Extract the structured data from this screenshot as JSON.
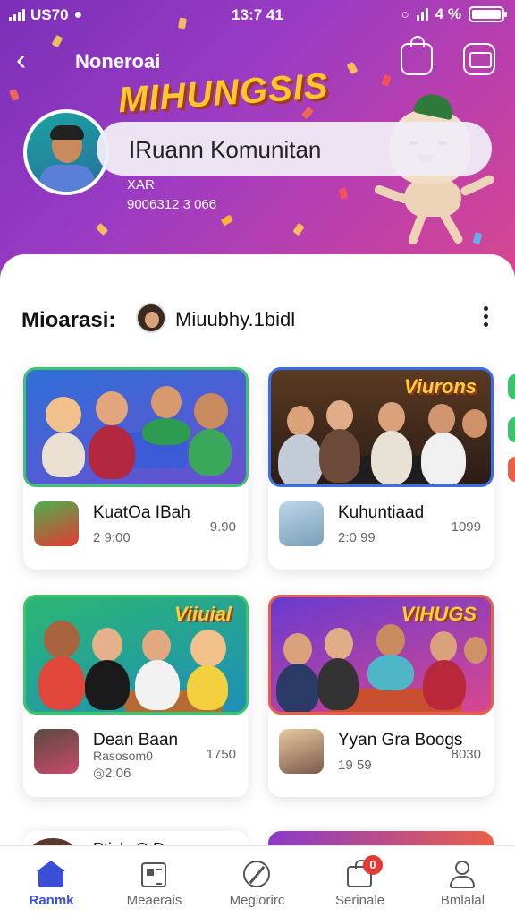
{
  "status": {
    "carrier": "US70",
    "time": "13:7 41",
    "battery": "4 %",
    "battery_level": 0.9
  },
  "header": {
    "title": "Noneroai",
    "banner_word": "MIHUNGSIS"
  },
  "profile": {
    "name": "IRuann Komunitan",
    "line1": "XAR",
    "line2": "9006312 3 066"
  },
  "section": {
    "title": "Mioarasi:",
    "user": "Miuubhy.1bidl"
  },
  "cards": [
    {
      "title": "KuatOa IBah",
      "sub": "2 9:00",
      "count": "9.90",
      "scene_title": ""
    },
    {
      "title": "Kuhuntiaad",
      "sub": "2:0 99",
      "count": "1099",
      "scene_title": "Viurons"
    },
    {
      "title": "Dean Baan",
      "sub": "Rasosom0",
      "sub2": "◎2:06",
      "count": "1750",
      "scene_title": "Viiuial"
    },
    {
      "title": "Yyan Gra Boogs",
      "sub": "19 59",
      "count": "8030",
      "scene_title": "VIHUGS"
    }
  ],
  "peek": {
    "label": "Ptisly O.D"
  },
  "tabs": [
    {
      "label": "Ranmk",
      "icon": "home-icon",
      "active": true
    },
    {
      "label": "Meaerais",
      "icon": "newspaper-icon",
      "active": false
    },
    {
      "label": "Megiorirc",
      "icon": "compass-icon",
      "active": false
    },
    {
      "label": "Serinale",
      "icon": "shopping-bag-icon",
      "active": false,
      "badge": "0"
    },
    {
      "label": "Bmlalal",
      "icon": "user-icon",
      "active": false
    }
  ],
  "colors": {
    "accent": "#3a4ed8",
    "hero_start": "#7a2fb8",
    "hero_end": "#d8478f",
    "badge": "#e53935"
  }
}
